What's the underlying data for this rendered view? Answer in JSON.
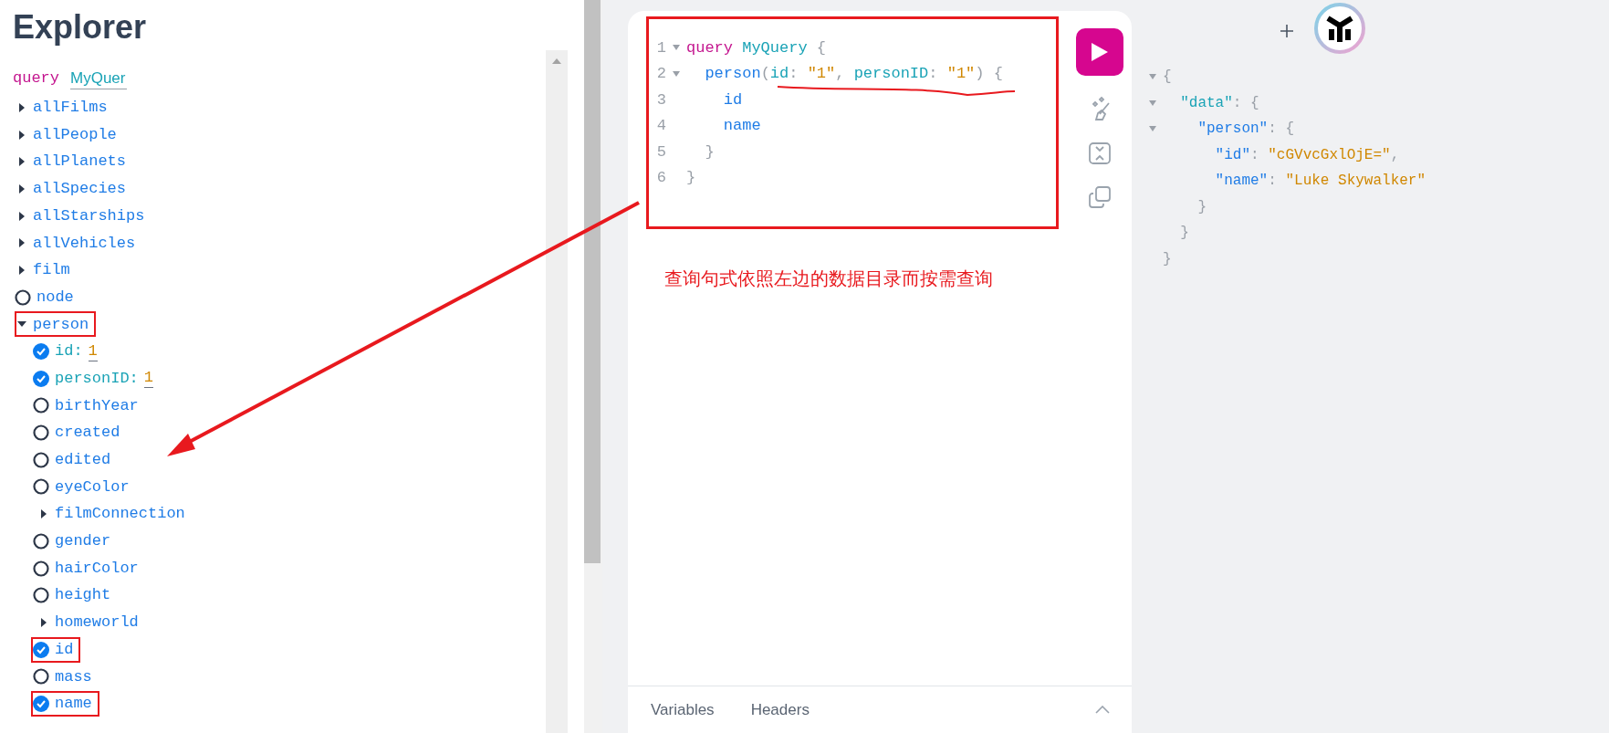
{
  "explorer": {
    "title": "Explorer",
    "operation": {
      "keyword": "query",
      "name": "MyQuer"
    },
    "fields": [
      {
        "name": "allFilms",
        "kind": "object",
        "expanded": false,
        "boxed": false
      },
      {
        "name": "allPeople",
        "kind": "object",
        "expanded": false,
        "boxed": false
      },
      {
        "name": "allPlanets",
        "kind": "object",
        "expanded": false,
        "boxed": false
      },
      {
        "name": "allSpecies",
        "kind": "object",
        "expanded": false,
        "boxed": false
      },
      {
        "name": "allStarships",
        "kind": "object",
        "expanded": false,
        "boxed": false
      },
      {
        "name": "allVehicles",
        "kind": "object",
        "expanded": false,
        "boxed": false
      },
      {
        "name": "film",
        "kind": "object",
        "expanded": false,
        "boxed": false
      },
      {
        "name": "node",
        "kind": "scalar",
        "checked": false,
        "boxed": false
      },
      {
        "name": "person",
        "kind": "object",
        "expanded": true,
        "boxed": true,
        "children": [
          {
            "name": "id:",
            "kind": "argument",
            "value": "1",
            "checked": true,
            "boxed": false
          },
          {
            "name": "personID:",
            "kind": "argument",
            "value": "1",
            "checked": true,
            "boxed": false
          },
          {
            "name": "birthYear",
            "kind": "scalar",
            "checked": false,
            "boxed": false
          },
          {
            "name": "created",
            "kind": "scalar",
            "checked": false,
            "boxed": false
          },
          {
            "name": "edited",
            "kind": "scalar",
            "checked": false,
            "boxed": false
          },
          {
            "name": "eyeColor",
            "kind": "scalar",
            "checked": false,
            "boxed": false
          },
          {
            "name": "filmConnection",
            "kind": "object",
            "expanded": false,
            "boxed": false
          },
          {
            "name": "gender",
            "kind": "scalar",
            "checked": false,
            "boxed": false
          },
          {
            "name": "hairColor",
            "kind": "scalar",
            "checked": false,
            "boxed": false
          },
          {
            "name": "height",
            "kind": "scalar",
            "checked": false,
            "boxed": false
          },
          {
            "name": "homeworld",
            "kind": "object",
            "expanded": false,
            "boxed": false
          },
          {
            "name": "id",
            "kind": "scalar",
            "checked": true,
            "boxed": true
          },
          {
            "name": "mass",
            "kind": "scalar",
            "checked": false,
            "boxed": false
          },
          {
            "name": "name",
            "kind": "scalar",
            "checked": true,
            "boxed": true
          }
        ]
      }
    ]
  },
  "editor": {
    "lines": [
      {
        "number": "1",
        "fold": true,
        "tokens": [
          {
            "text": "query ",
            "kind": "keyword"
          },
          {
            "text": "MyQuery ",
            "kind": "def"
          },
          {
            "text": "{",
            "kind": "punct"
          }
        ]
      },
      {
        "number": "2",
        "fold": true,
        "tokens": [
          {
            "text": "  person",
            "kind": "field"
          },
          {
            "text": "(",
            "kind": "punct"
          },
          {
            "text": "id",
            "kind": "arg"
          },
          {
            "text": ": ",
            "kind": "punct"
          },
          {
            "text": "\"1\"",
            "kind": "string"
          },
          {
            "text": ", ",
            "kind": "punct"
          },
          {
            "text": "personID",
            "kind": "arg"
          },
          {
            "text": ": ",
            "kind": "punct"
          },
          {
            "text": "\"1\"",
            "kind": "string"
          },
          {
            "text": ") {",
            "kind": "punct"
          }
        ]
      },
      {
        "number": "3",
        "fold": false,
        "tokens": [
          {
            "text": "    id",
            "kind": "field"
          }
        ]
      },
      {
        "number": "4",
        "fold": false,
        "tokens": [
          {
            "text": "    name",
            "kind": "field"
          }
        ]
      },
      {
        "number": "5",
        "fold": false,
        "tokens": [
          {
            "text": "  }",
            "kind": "punct"
          }
        ]
      },
      {
        "number": "6",
        "fold": false,
        "tokens": [
          {
            "text": "}",
            "kind": "punct"
          }
        ]
      }
    ],
    "note": "查询句式依照左边的数据目录而按需查询",
    "bottom_tabs": [
      "Variables",
      "Headers"
    ]
  },
  "result": {
    "lines": [
      {
        "fold": true,
        "tokens": [
          {
            "text": "{",
            "kind": "punct"
          }
        ]
      },
      {
        "fold": true,
        "tokens": [
          {
            "text": "  \"data\"",
            "kind": "def"
          },
          {
            "text": ": {",
            "kind": "punct"
          }
        ]
      },
      {
        "fold": true,
        "tokens": [
          {
            "text": "    \"person\"",
            "kind": "field"
          },
          {
            "text": ": {",
            "kind": "punct"
          }
        ]
      },
      {
        "fold": false,
        "tokens": [
          {
            "text": "      \"id\"",
            "kind": "field"
          },
          {
            "text": ": ",
            "kind": "punct"
          },
          {
            "text": "\"cGVvcGxlOjE=\"",
            "kind": "string"
          },
          {
            "text": ",",
            "kind": "punct"
          }
        ]
      },
      {
        "fold": false,
        "tokens": [
          {
            "text": "      \"name\"",
            "kind": "field"
          },
          {
            "text": ": ",
            "kind": "punct"
          },
          {
            "text": "\"Luke Skywalker\"",
            "kind": "string"
          }
        ]
      },
      {
        "fold": false,
        "tokens": [
          {
            "text": "    }",
            "kind": "punct"
          }
        ]
      },
      {
        "fold": false,
        "tokens": [
          {
            "text": "  }",
            "kind": "punct"
          }
        ]
      },
      {
        "fold": false,
        "tokens": [
          {
            "text": "}",
            "kind": "punct"
          }
        ]
      }
    ]
  }
}
